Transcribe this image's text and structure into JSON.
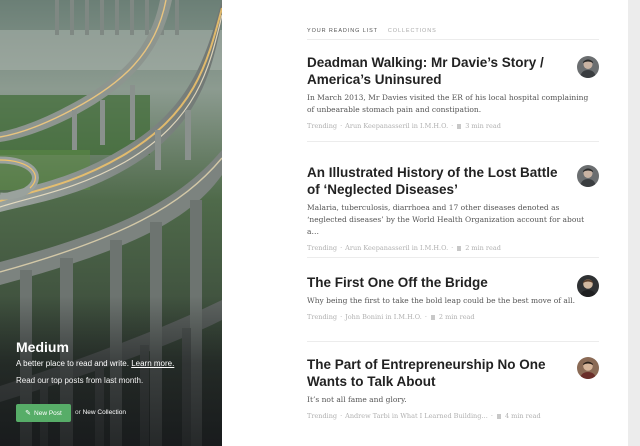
{
  "hero": {
    "brand": "Medium",
    "tagline_text": "A better place to read and write.",
    "tagline_link": "Learn more.",
    "subline": "Read our top posts from last month.",
    "new_post_label": "New Post",
    "new_collection_or": "or",
    "new_collection_label": "New Collection"
  },
  "tabs": [
    {
      "label": "Your Reading List",
      "active": true
    },
    {
      "label": "Collections",
      "active": false
    }
  ],
  "posts": [
    {
      "title": "Deadman Walking: Mr Davie’s Story / America’s Uninsured",
      "snippet": "In March 2013, Mr Davies visited the ER of his local hospital complaining of unbearable stomach pain and constipation.",
      "category": "Trending",
      "author": "Arun Keepanasseril in I.M.H.O.",
      "read_time": "3 min read"
    },
    {
      "title": "An Illustrated History of the Lost Battle of ‘Neglected Diseases’",
      "snippet": "Malaria, tuberculosis, diarrhoea and 17 other diseases denoted as ‘neglected diseases’ by the World Health Organization account for about a…",
      "category": "Trending",
      "author": "Arun Keepanasseril in I.M.H.O.",
      "read_time": "2 min read"
    },
    {
      "title": "The First One Off the Bridge",
      "snippet": "Why being the first to take the bold leap could be the best move of all.",
      "category": "Trending",
      "author": "John Bonini in I.M.H.O.",
      "read_time": "2 min read"
    },
    {
      "title": "The Part of Entrepreneurship No One Wants to Talk About",
      "snippet": "It’s not all fame and glory.",
      "category": "Trending",
      "author": "Andrew Tarbi in What I Learned Building…",
      "read_time": "4 min read"
    }
  ],
  "meta_separator": "·",
  "colors": {
    "new_post_green": "#57ad68",
    "title_text": "#222222",
    "meta_text": "#b0b0b0"
  },
  "icons": {
    "bookmark": "bookmark-icon",
    "pen": "pen-icon"
  }
}
